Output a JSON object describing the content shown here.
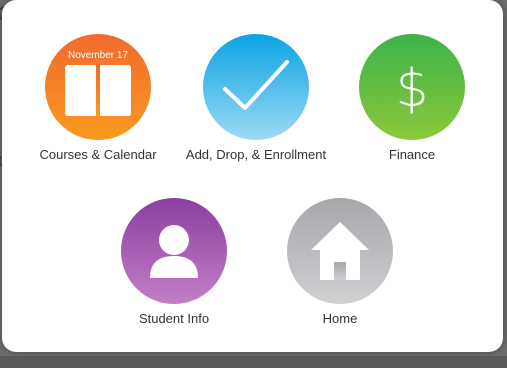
{
  "tiles": [
    {
      "id": "courses",
      "label": "Courses & Calendar",
      "icon": "calendar-book-icon",
      "calendar_date": "November 17",
      "gradient": [
        "#f26a2e",
        "#f79a1e"
      ]
    },
    {
      "id": "enrollment",
      "label": "Add, Drop, & Enrollment",
      "icon": "checkmark-icon",
      "gradient": [
        "#0aa4e2",
        "#9dd9f5"
      ]
    },
    {
      "id": "finance",
      "label": "Finance",
      "icon": "dollar-icon",
      "gradient": [
        "#3bb34a",
        "#8cc83c"
      ]
    },
    {
      "id": "student",
      "label": "Student Info",
      "icon": "person-icon",
      "gradient": [
        "#8b3fa0",
        "#c37ec7"
      ]
    },
    {
      "id": "home",
      "label": "Home",
      "icon": "house-icon",
      "gradient": [
        "#a5a7aa",
        "#cfd0d2"
      ]
    }
  ]
}
